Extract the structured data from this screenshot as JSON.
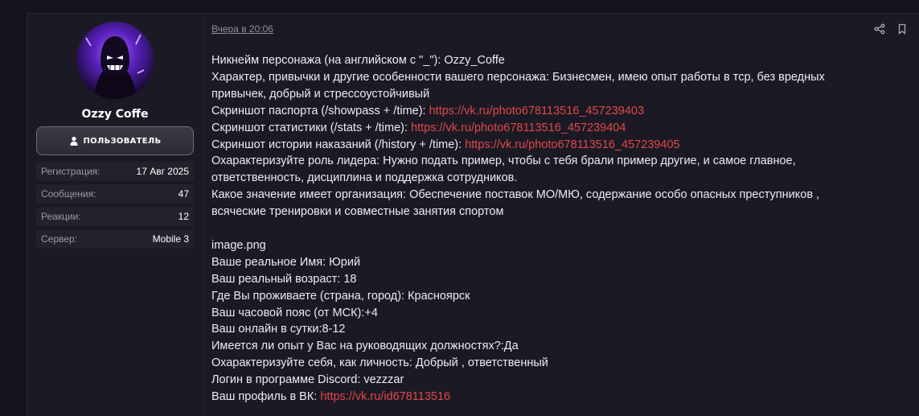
{
  "user": {
    "name": "Ozzy Coffe",
    "role": "ПОЛЬЗОВАТЕЛЬ",
    "stats": [
      {
        "label": "Регистрация:",
        "value": "17 Авг 2025"
      },
      {
        "label": "Сообщения:",
        "value": "47"
      },
      {
        "label": "Реакции:",
        "value": "12"
      },
      {
        "label": "Сервер:",
        "value": "Mobile 3"
      }
    ]
  },
  "post": {
    "date": "Вчера в 20:06",
    "lines": [
      {
        "text": "Никнейм персонажа (на английском с \"_\"): Ozzy_Coffe",
        "link": ""
      },
      {
        "text": "Характер, привычки и другие особенности вашего персонажа: Бизнесмен, имею опыт работы в тср, без вредных",
        "link": ""
      },
      {
        "text": "привычек, добрый и стрессоустойчивый",
        "link": ""
      },
      {
        "text": "Скриншот паспорта (/showpass + /time): ",
        "link": "https://vk.ru/photo678113516_457239403"
      },
      {
        "text": "Скриншот статистики (/stats + /time): ",
        "link": "https://vk.ru/photo678113516_457239404"
      },
      {
        "text": "Скриншот истории наказаний (/history + /time): ",
        "link": "https://vk.ru/photo678113516_457239405"
      },
      {
        "text": "Охарактеризуйте роль лидера: Нужно подать пример, чтобы с тебя брали пример другие, и самое главное,",
        "link": ""
      },
      {
        "text": "ответственность, дисциплина и поддержка сотрудников.",
        "link": ""
      },
      {
        "text": "Какое значение имеет организация: Обеспечение поставок МО/МЮ, содержание особо опасных преступников ,",
        "link": ""
      },
      {
        "text": "всяческие тренировки и совместные занятия спортом",
        "link": ""
      },
      {
        "text": "",
        "link": ""
      },
      {
        "text": "image.png",
        "link": ""
      },
      {
        "text": "Ваше реальное Имя: Юрий",
        "link": ""
      },
      {
        "text": "Ваш реальный возраст: 18",
        "link": ""
      },
      {
        "text": "Где Вы проживаете (страна, город): Красноярск",
        "link": ""
      },
      {
        "text": "Ваш часовой пояс (от МСК):+4",
        "link": ""
      },
      {
        "text": "Ваш онлайн в сутки:8-12",
        "link": ""
      },
      {
        "text": "Имеется ли опыт у Вас на руководящих должностях?:Да",
        "link": ""
      },
      {
        "text": "Охарактеризуйте себя, как личность: Добрый , ответственный",
        "link": ""
      },
      {
        "text": "Логин в программе Discord: vezzzar",
        "link": ""
      },
      {
        "text": "Ваш профиль в ВК: ",
        "link": "https://vk.ru/id678113516"
      }
    ]
  },
  "icons": {
    "share": "share-icon",
    "bookmark": "bookmark-icon",
    "user": "user-icon"
  },
  "colors": {
    "link": "#e04848",
    "background": "#15141d",
    "panel": "#1b1a24"
  }
}
